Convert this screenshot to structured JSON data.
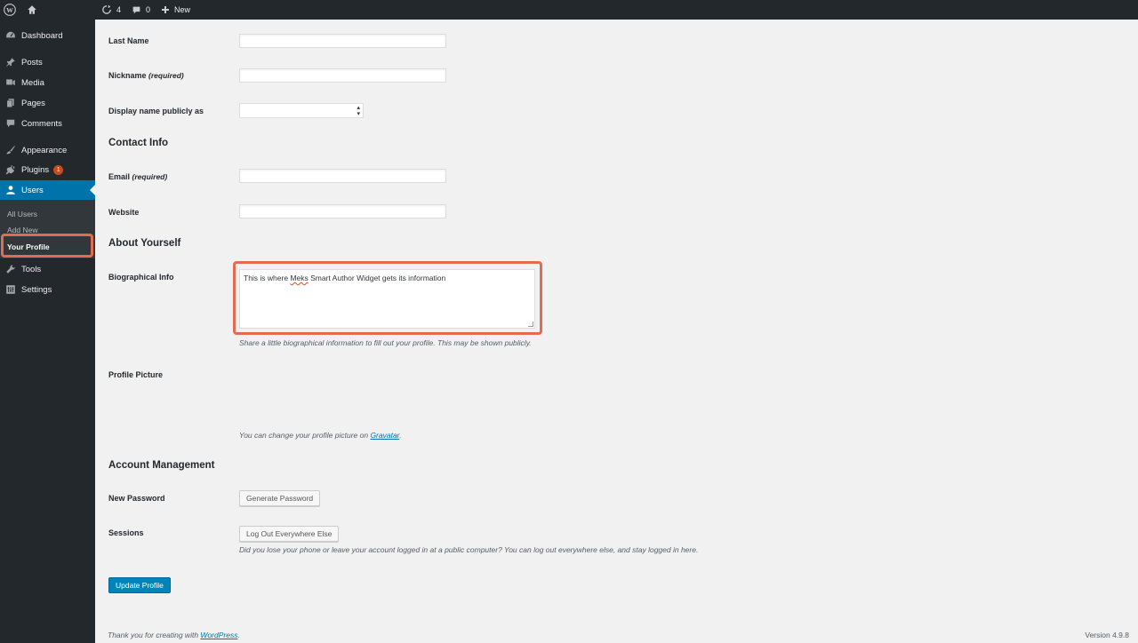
{
  "adminbar": {
    "updates_count": "4",
    "comments_count": "0",
    "new_label": "New"
  },
  "sidebar": {
    "items": [
      {
        "label": "Dashboard",
        "icon": "dashboard-icon"
      },
      {
        "label": "Posts",
        "icon": "pin-icon"
      },
      {
        "label": "Media",
        "icon": "media-icon"
      },
      {
        "label": "Pages",
        "icon": "pages-icon"
      },
      {
        "label": "Comments",
        "icon": "comment-icon"
      },
      {
        "label": "Appearance",
        "icon": "brush-icon"
      },
      {
        "label": "Plugins",
        "icon": "plug-icon",
        "badge": "1"
      },
      {
        "label": "Users",
        "icon": "user-icon"
      },
      {
        "label": "Tools",
        "icon": "wrench-icon"
      },
      {
        "label": "Settings",
        "icon": "settings-icon"
      }
    ],
    "submenu": [
      "All Users",
      "Add New",
      "Your Profile"
    ]
  },
  "form": {
    "last_name_label": "Last Name",
    "nickname_label": "Nickname",
    "nickname_required": "(required)",
    "display_name_label": "Display name publicly as",
    "contact_info_title": "Contact Info",
    "email_label": "Email",
    "email_required": "(required)",
    "website_label": "Website",
    "about_title": "About Yourself",
    "bio_label": "Biographical Info",
    "bio_value_pre": "This is where ",
    "bio_value_misspelled": "Meks",
    "bio_value_post": " Smart Author Widget gets its information",
    "bio_description": "Share a little biographical information to fill out your profile. This may be shown publicly.",
    "profile_picture_label": "Profile Picture",
    "profile_picture_desc_pre": "You can change your profile picture on ",
    "profile_picture_link": "Gravatar",
    "profile_picture_desc_post": ".",
    "account_title": "Account Management",
    "new_password_label": "New Password",
    "generate_password_button": "Generate Password",
    "sessions_label": "Sessions",
    "logout_button": "Log Out Everywhere Else",
    "sessions_desc": "Did you lose your phone or leave your account logged in at a public computer? You can log out everywhere else, and stay logged in here.",
    "update_button": "Update Profile"
  },
  "footer": {
    "thanks_pre": "Thank you for creating with ",
    "thanks_link": "WordPress",
    "thanks_post": ".",
    "version": "Version 4.9.8"
  },
  "colors": {
    "adminbar_bg": "#23282d",
    "accent": "#0073aa",
    "highlight": "#e36b53",
    "badge": "#ca4a1f"
  }
}
